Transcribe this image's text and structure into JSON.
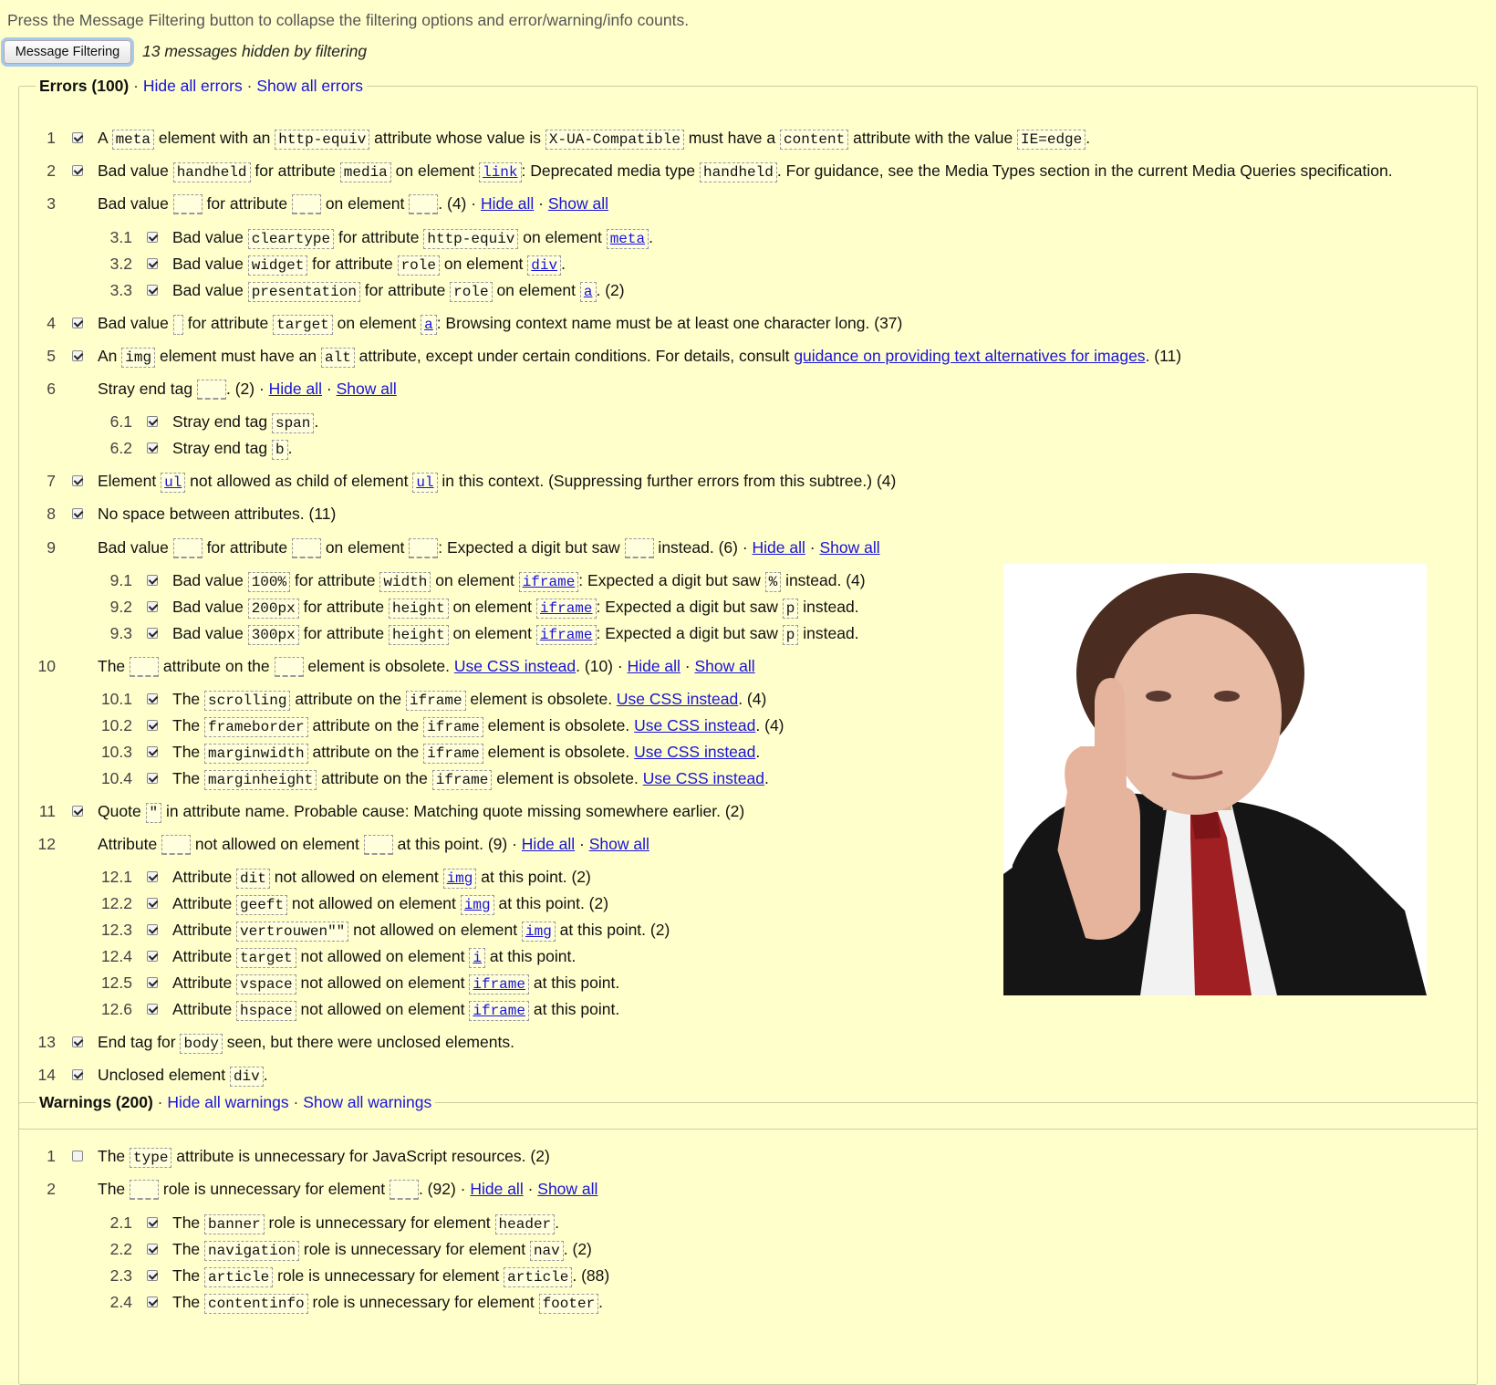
{
  "intro": "Press the Message Filtering button to collapse the filtering options and error/warning/info counts.",
  "filter_button": "Message Filtering",
  "hidden_count": "13 messages hidden by filtering",
  "errors": {
    "heading": "Errors (100)",
    "hide_all": "Hide all errors",
    "show_all": "Show all errors"
  },
  "warnings": {
    "heading": "Warnings (200)",
    "hide_all": "Hide all warnings",
    "show_all": "Show all warnings"
  },
  "links": {
    "hide_all": "Hide all",
    "show_all": "Show all",
    "use_css": "Use CSS instead",
    "guidance": "guidance on providing text alternatives for images"
  },
  "error_rows": [
    {
      "n": "1",
      "checked": true,
      "sub": false,
      "parts": [
        "A ",
        "[meta]",
        " element with an ",
        "[http-equiv]",
        " attribute whose value is ",
        "[X-UA-Compatible]",
        " must have a ",
        "[content]",
        " attribute with the value ",
        "[IE=edge]",
        "."
      ]
    },
    {
      "n": "2",
      "checked": true,
      "sub": false,
      "parts": [
        "Bad value ",
        "[handheld]",
        " for attribute ",
        "[media]",
        " on element ",
        "{link}",
        ": Deprecated media type ",
        "[handheld]",
        ". For guidance, see the Media Types section in the current Media Queries specification."
      ]
    },
    {
      "n": "3",
      "checked": null,
      "sub": false,
      "parts": [
        "Bad value ",
        "_",
        " for attribute ",
        "_",
        " on element ",
        "_",
        ". (4) · ",
        "#hide",
        " · ",
        "#show"
      ]
    },
    {
      "n": "3.1",
      "checked": true,
      "sub": true,
      "parts": [
        "Bad value ",
        "[cleartype]",
        " for attribute ",
        "[http-equiv]",
        " on element ",
        "{meta}",
        "."
      ]
    },
    {
      "n": "3.2",
      "checked": true,
      "sub": true,
      "parts": [
        "Bad value ",
        "[widget]",
        " for attribute ",
        "[role]",
        " on element ",
        "{div}",
        "."
      ]
    },
    {
      "n": "3.3",
      "checked": true,
      "sub": true,
      "parts": [
        "Bad value ",
        "[presentation]",
        " for attribute ",
        "[role]",
        " on element ",
        "{a}",
        ". (2)"
      ]
    },
    {
      "n": "4",
      "checked": true,
      "sub": false,
      "parts": [
        "Bad value ",
        "[]",
        " for attribute ",
        "[target]",
        " on element ",
        "{a}",
        ": Browsing context name must be at least one character long. (37)"
      ]
    },
    {
      "n": "5",
      "checked": true,
      "sub": false,
      "parts": [
        "An ",
        "[img]",
        " element must have an ",
        "[alt]",
        " attribute, except under certain conditions. For details, consult ",
        "#guide",
        ". (11)"
      ]
    },
    {
      "n": "6",
      "checked": null,
      "sub": false,
      "parts": [
        "Stray end tag ",
        "_",
        ". (2) · ",
        "#hide",
        " · ",
        "#show"
      ]
    },
    {
      "n": "6.1",
      "checked": true,
      "sub": true,
      "parts": [
        "Stray end tag ",
        "[span]",
        "."
      ]
    },
    {
      "n": "6.2",
      "checked": true,
      "sub": true,
      "parts": [
        "Stray end tag ",
        "[b]",
        "."
      ]
    },
    {
      "n": "7",
      "checked": true,
      "sub": false,
      "parts": [
        "Element ",
        "{ul}",
        " not allowed as child of element ",
        "{ul}",
        " in this context. (Suppressing further errors from this subtree.) (4)"
      ]
    },
    {
      "n": "8",
      "checked": true,
      "sub": false,
      "parts": [
        "No space between attributes. (11)"
      ]
    },
    {
      "n": "9",
      "checked": null,
      "sub": false,
      "parts": [
        "Bad value ",
        "_",
        " for attribute ",
        "_",
        " on element ",
        "_",
        ": Expected a digit but saw ",
        "_",
        " instead. (6) · ",
        "#hide",
        " · ",
        "#show"
      ]
    },
    {
      "n": "9.1",
      "checked": true,
      "sub": true,
      "parts": [
        "Bad value ",
        "[100%]",
        " for attribute ",
        "[width]",
        " on element ",
        "{iframe}",
        ": Expected a digit but saw ",
        "[%]",
        " instead. (4)"
      ]
    },
    {
      "n": "9.2",
      "checked": true,
      "sub": true,
      "parts": [
        "Bad value ",
        "[200px]",
        " for attribute ",
        "[height]",
        " on element ",
        "{iframe}",
        ": Expected a digit but saw ",
        "[p]",
        " instead."
      ]
    },
    {
      "n": "9.3",
      "checked": true,
      "sub": true,
      "parts": [
        "Bad value ",
        "[300px]",
        " for attribute ",
        "[height]",
        " on element ",
        "{iframe}",
        ": Expected a digit but saw ",
        "[p]",
        " instead."
      ]
    },
    {
      "n": "10",
      "checked": null,
      "sub": false,
      "parts": [
        "The ",
        "_",
        " attribute on the ",
        "_",
        " element is obsolete. ",
        "#css",
        ". (10) · ",
        "#hide",
        " · ",
        "#show"
      ]
    },
    {
      "n": "10.1",
      "checked": true,
      "sub": true,
      "parts": [
        "The ",
        "[scrolling]",
        " attribute on the ",
        "[iframe]",
        " element is obsolete. ",
        "#css",
        ". (4)"
      ]
    },
    {
      "n": "10.2",
      "checked": true,
      "sub": true,
      "parts": [
        "The ",
        "[frameborder]",
        " attribute on the ",
        "[iframe]",
        " element is obsolete. ",
        "#css",
        ". (4)"
      ]
    },
    {
      "n": "10.3",
      "checked": true,
      "sub": true,
      "parts": [
        "The ",
        "[marginwidth]",
        " attribute on the ",
        "[iframe]",
        " element is obsolete. ",
        "#css",
        "."
      ]
    },
    {
      "n": "10.4",
      "checked": true,
      "sub": true,
      "parts": [
        "The ",
        "[marginheight]",
        " attribute on the ",
        "[iframe]",
        " element is obsolete. ",
        "#css",
        "."
      ]
    },
    {
      "n": "11",
      "checked": true,
      "sub": false,
      "parts": [
        "Quote ",
        "[\"]",
        " in attribute name. Probable cause: Matching quote missing somewhere earlier. (2)"
      ]
    },
    {
      "n": "12",
      "checked": null,
      "sub": false,
      "parts": [
        "Attribute ",
        "_",
        " not allowed on element ",
        "_",
        " at this point. (9) · ",
        "#hide",
        " · ",
        "#show"
      ]
    },
    {
      "n": "12.1",
      "checked": true,
      "sub": true,
      "parts": [
        "Attribute ",
        "[dit]",
        " not allowed on element ",
        "{img}",
        " at this point. (2)"
      ]
    },
    {
      "n": "12.2",
      "checked": true,
      "sub": true,
      "parts": [
        "Attribute ",
        "[geeft]",
        " not allowed on element ",
        "{img}",
        " at this point. (2)"
      ]
    },
    {
      "n": "12.3",
      "checked": true,
      "sub": true,
      "parts": [
        "Attribute ",
        "[vertrouwen\"\"]",
        " not allowed on element ",
        "{img}",
        " at this point. (2)"
      ]
    },
    {
      "n": "12.4",
      "checked": true,
      "sub": true,
      "parts": [
        "Attribute ",
        "[target]",
        " not allowed on element ",
        "{i}",
        " at this point."
      ]
    },
    {
      "n": "12.5",
      "checked": true,
      "sub": true,
      "parts": [
        "Attribute ",
        "[vspace]",
        " not allowed on element ",
        "{iframe}",
        " at this point."
      ]
    },
    {
      "n": "12.6",
      "checked": true,
      "sub": true,
      "parts": [
        "Attribute ",
        "[hspace]",
        " not allowed on element ",
        "{iframe}",
        " at this point."
      ]
    },
    {
      "n": "13",
      "checked": true,
      "sub": false,
      "parts": [
        "End tag for ",
        "[body]",
        " seen, but there were unclosed elements."
      ]
    },
    {
      "n": "14",
      "checked": true,
      "sub": false,
      "parts": [
        "Unclosed element ",
        "[div]",
        "."
      ]
    }
  ],
  "warning_rows": [
    {
      "n": "1",
      "checked": false,
      "sub": false,
      "parts": [
        "The ",
        "[type]",
        " attribute is unnecessary for JavaScript resources. (2)"
      ]
    },
    {
      "n": "2",
      "checked": null,
      "sub": false,
      "parts": [
        "The ",
        "_",
        " role is unnecessary for element ",
        "_",
        ". (92) · ",
        "#hide",
        " · ",
        "#show"
      ]
    },
    {
      "n": "2.1",
      "checked": true,
      "sub": true,
      "parts": [
        "The ",
        "[banner]",
        " role is unnecessary for element ",
        "[header]",
        "."
      ]
    },
    {
      "n": "2.2",
      "checked": true,
      "sub": true,
      "parts": [
        "The ",
        "[navigation]",
        " role is unnecessary for element ",
        "[nav]",
        ". (2)"
      ]
    },
    {
      "n": "2.3",
      "checked": true,
      "sub": true,
      "parts": [
        "The ",
        "[article]",
        " role is unnecessary for element ",
        "[article]",
        ". (88)"
      ]
    },
    {
      "n": "2.4",
      "checked": true,
      "sub": true,
      "parts": [
        "The ",
        "[contentinfo]",
        " role is unnecessary for element ",
        "[footer]",
        "."
      ]
    }
  ]
}
